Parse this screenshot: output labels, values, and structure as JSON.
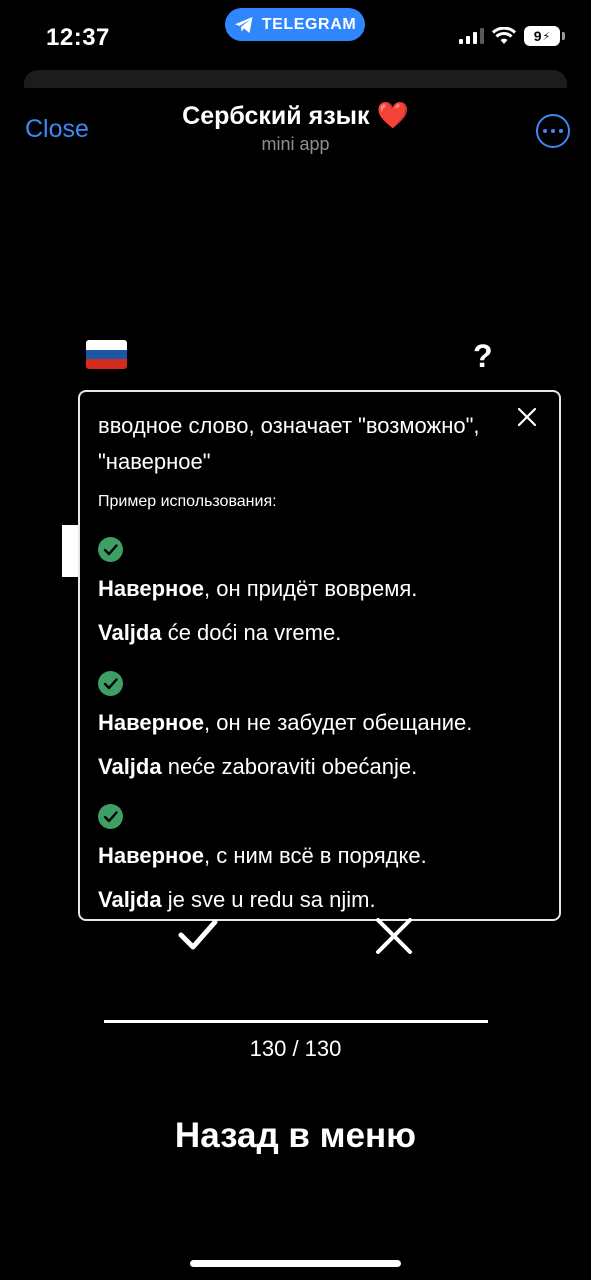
{
  "status_bar": {
    "time": "12:37",
    "app_pill": "TELEGRAM",
    "battery": "9",
    "accent": "#2f86ff"
  },
  "header": {
    "close_label": "Close",
    "title": "Сербский язык",
    "title_emoji": "❤️",
    "subtitle": "mini app",
    "link_color": "#3e88f7"
  },
  "card": {
    "language_flag": "russia-flag-icon",
    "help_label": "?"
  },
  "popup": {
    "definition": "вводное слово, означает \"возможно\", \"наверное\"",
    "usage_heading": "Пример использования:",
    "check_color": "#3d9f63",
    "examples": [
      {
        "ru_bold": "Наверное",
        "ru_rest": ", он придёт вовремя.",
        "sr_bold": "Valjda",
        "sr_rest": " će doći na vreme."
      },
      {
        "ru_bold": "Наверное",
        "ru_rest": ", он не забудет обещание.",
        "sr_bold": "Valjda",
        "sr_rest": " neće zaboraviti obećanje."
      },
      {
        "ru_bold": "Наверное",
        "ru_rest": ", с ним всё в порядке.",
        "sr_bold": "Valjda",
        "sr_rest": " je sve u redu sa njim."
      }
    ]
  },
  "progress": {
    "counter": "130 / 130",
    "current": 130,
    "total": 130
  },
  "footer": {
    "back_label": "Назад в меню"
  }
}
